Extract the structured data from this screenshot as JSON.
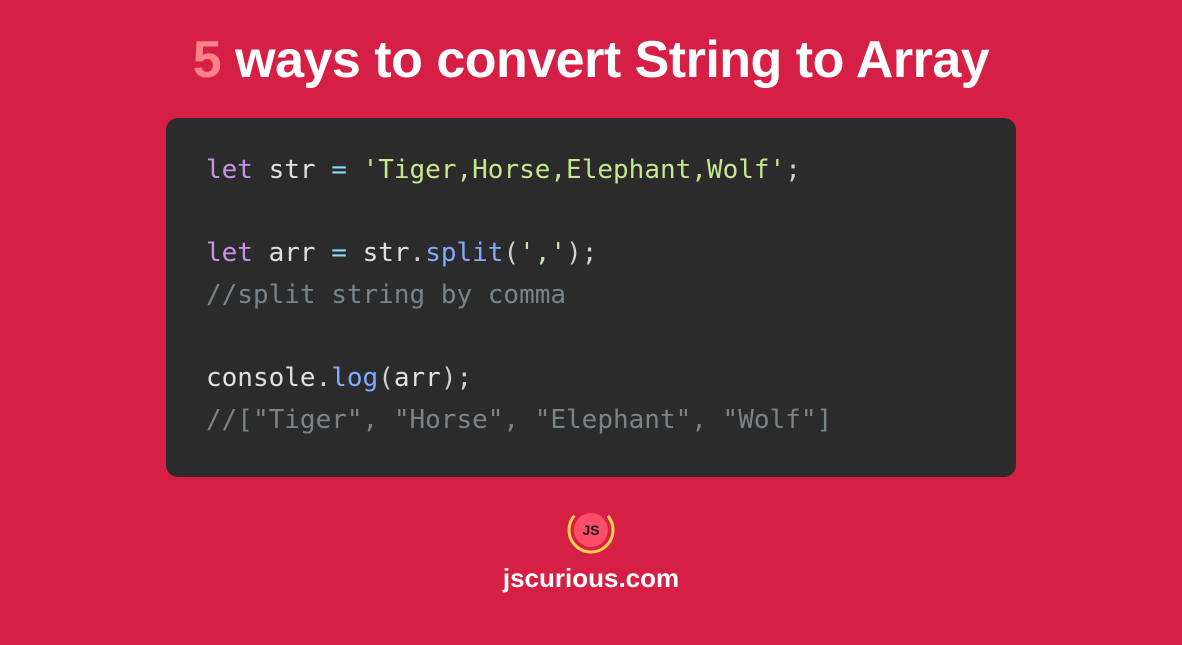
{
  "title": {
    "accent": "5",
    "rest": " ways to convert String to Array"
  },
  "code": {
    "line1_let": "let",
    "line1_var": " str ",
    "line1_eq": "= ",
    "line1_str": "'Tiger,Horse,Elephant,Wolf'",
    "line1_semi": ";",
    "line2_let": "let",
    "line2_var": " arr ",
    "line2_eq": "= ",
    "line2_obj": "str",
    "line2_dot": ".",
    "line2_fn": "split",
    "line2_open": "(",
    "line2_arg": "','",
    "line2_close": ")",
    "line2_semi": ";",
    "line3_comment": "//split string by comma",
    "line4_obj": "console",
    "line4_dot": ".",
    "line4_fn": "log",
    "line4_open": "(",
    "line4_arg": "arr",
    "line4_close": ")",
    "line4_semi": ";",
    "line5_comment": "//[\"Tiger\", \"Horse\", \"Elephant\", \"Wolf\"]"
  },
  "logo_text": "JS",
  "site": "jscurious.com"
}
